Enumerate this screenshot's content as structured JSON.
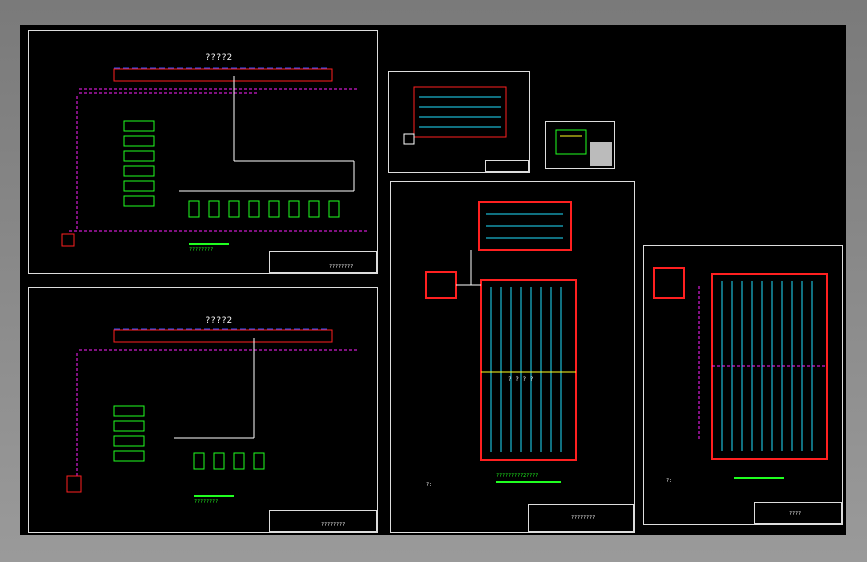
{
  "app": {
    "background": "#8c8c8c",
    "canvas_color": "#000000"
  },
  "sheets": {
    "top_left": {
      "title": "????2",
      "caption": "????????",
      "tb_label": "????????"
    },
    "bottom_left": {
      "title": "????2",
      "caption": "????????",
      "tb_label": "????????"
    },
    "pool_main": {
      "caption": "?????????2????",
      "labels": [
        "?",
        "?",
        "?",
        "?",
        "?"
      ],
      "notes": "?:",
      "tb_label": "????????"
    },
    "right": {
      "notes": "?:",
      "tb_label": "????"
    }
  },
  "colors": {
    "pipe_red": "#ff2020",
    "pipe_blue": "#3050ff",
    "pipe_green": "#20ff20",
    "magenta": "#ff20ff",
    "yellow": "#ffff20",
    "cyan": "#20e0ff",
    "white": "#ffffff"
  }
}
